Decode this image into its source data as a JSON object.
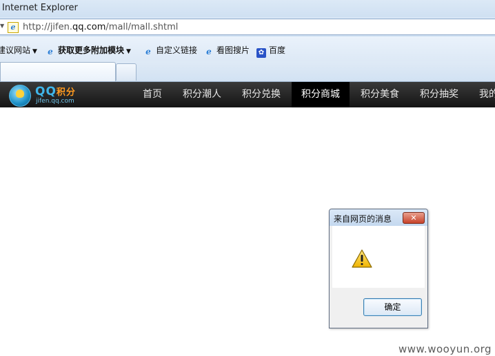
{
  "browser": {
    "window_title": "Internet Explorer",
    "address": {
      "url_prefix": "http://jifen.",
      "url_domain": "qq.com",
      "url_path": "/mall/mall.shtml"
    },
    "favorites": [
      {
        "label": "建议网站",
        "icon": "ie-icon",
        "has_dropdown": true
      },
      {
        "label": "获取更多附加模块",
        "icon": "ie-icon",
        "has_dropdown": true
      },
      {
        "label": "自定义链接",
        "icon": "ie-icon"
      },
      {
        "label": "看图搜片",
        "icon": "ie-icon"
      },
      {
        "label": "百度",
        "icon": "baidu-paw-icon"
      }
    ]
  },
  "site": {
    "logo": {
      "main": "QQ",
      "accent": "积分",
      "sub": "jifen.qq.com"
    },
    "nav": [
      {
        "label": "首页"
      },
      {
        "label": "积分潮人"
      },
      {
        "label": "积分兑换"
      },
      {
        "label": "积分商城",
        "active": true
      },
      {
        "label": "积分美食"
      },
      {
        "label": "积分抽奖"
      },
      {
        "label": "我的"
      }
    ]
  },
  "dialog": {
    "title": "来自网页的消息",
    "icon": "warning-icon",
    "ok_label": "确定"
  },
  "watermark": "www.wooyun.org",
  "colors": {
    "nav_bg": "#1e1e1e",
    "nav_active_bg": "#000000",
    "dialog_close": "#c7422a",
    "ok_border": "#3c7fb1"
  }
}
